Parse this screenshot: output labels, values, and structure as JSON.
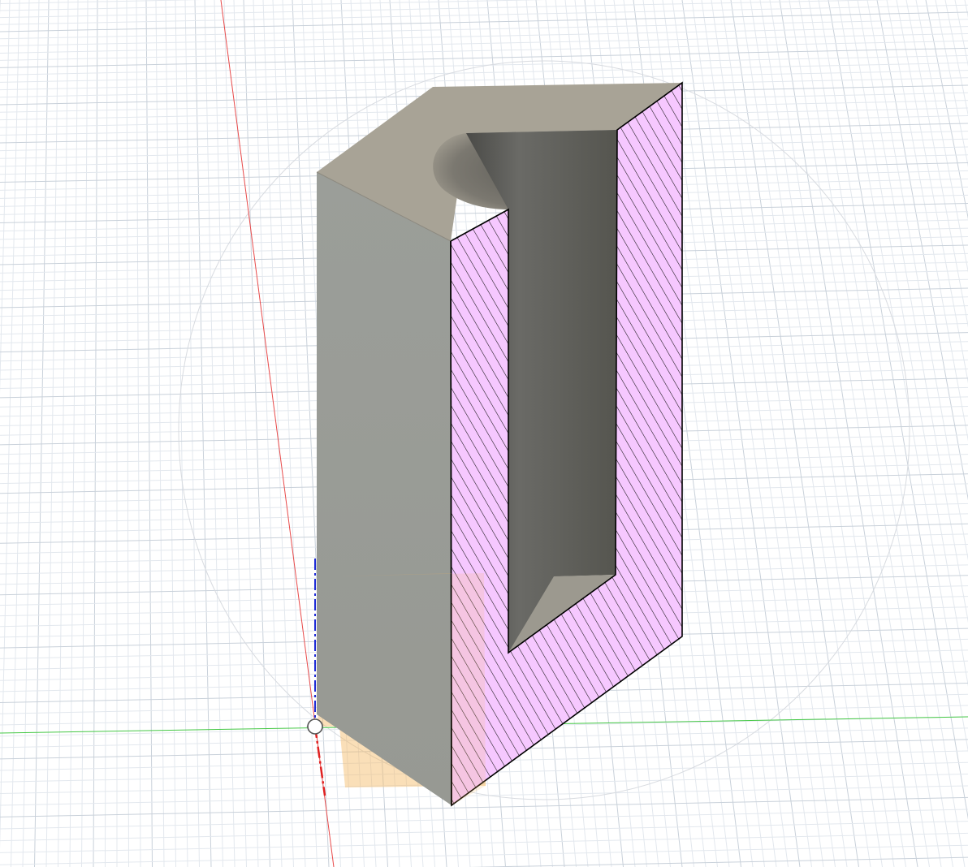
{
  "viewport": {
    "background": "#ffffff",
    "grid_minor_color": "#e3e8ee",
    "grid_major_color": "#c9d1da"
  },
  "axes": {
    "x_axis_color": "#e03030",
    "y_axis_color": "#2ec02e",
    "z_axis_color": "#1e2bd6"
  },
  "model": {
    "top_face_color": "#a8a396",
    "left_face_color": "#9a9d98",
    "section_fill_color": "#f6c8ff",
    "hatch_color": "#111111",
    "cavity_back_color": "#5a5a56",
    "cavity_floor_color": "#9c998f"
  },
  "section_plane": {
    "color": "#f5b861",
    "opacity": 0.5
  },
  "icons": {
    "origin_icon": "origin-point-icon",
    "pivot_icon": "orbit-pivot-icon"
  }
}
